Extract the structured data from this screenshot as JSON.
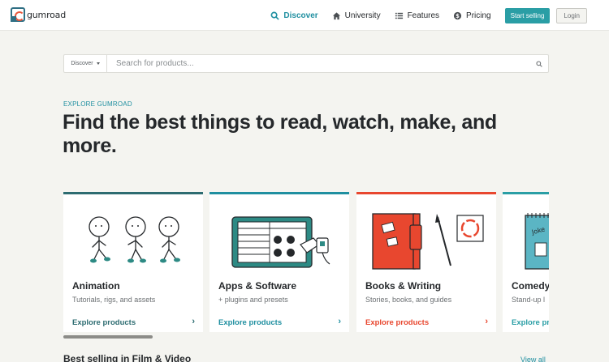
{
  "brand": {
    "name": "gumroad"
  },
  "nav": {
    "items": [
      {
        "label": "Discover",
        "icon": "search-icon",
        "active": true
      },
      {
        "label": "University",
        "icon": "house-icon",
        "active": false
      },
      {
        "label": "Features",
        "icon": "list-icon",
        "active": false
      },
      {
        "label": "Pricing",
        "icon": "dollar-icon",
        "active": false
      }
    ],
    "start_selling": "Start selling",
    "login": "Login"
  },
  "search": {
    "category": "Discover",
    "placeholder": "Search for products..."
  },
  "hero": {
    "eyebrow": "EXPLORE GUMROAD",
    "title": "Find the best things to read, watch, make, and more."
  },
  "categories": [
    {
      "title": "Animation",
      "subtitle": "Tutorials, rigs, and assets",
      "link": "Explore products",
      "accent": "#2d6c71"
    },
    {
      "title": "Apps & Software",
      "subtitle": "+ plugins and presets",
      "link": "Explore products",
      "accent": "#1f8fa0"
    },
    {
      "title": "Books & Writing",
      "subtitle": "Stories, books, and guides",
      "link": "Explore products",
      "accent": "#e8472f"
    },
    {
      "title": "Comedy",
      "subtitle": "Stand-up l",
      "link": "Explore products",
      "accent": "#2a9ea5"
    }
  ],
  "section": {
    "title": "Best selling in Film & Video",
    "view_all": "View all"
  },
  "colors": {
    "accent": "#2a9ea5",
    "link_teal": "#1f8fa0",
    "red": "#e8472f"
  }
}
